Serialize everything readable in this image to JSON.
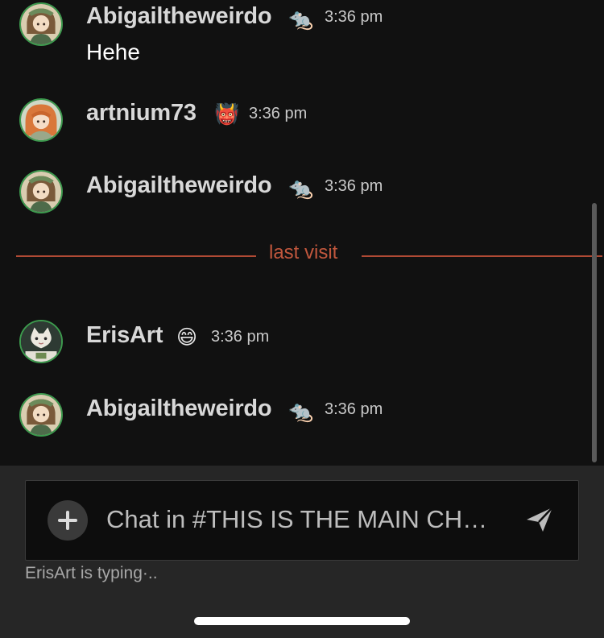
{
  "messages": [
    {
      "username": "Abigailtheweirdo",
      "badge": "🐀",
      "time": "3:36 pm",
      "text": "Hehe",
      "avatar": "anime-girl-avatar"
    },
    {
      "username": "artnium73",
      "badge": "👹",
      "time": "3:36 pm",
      "text": "",
      "avatar": "orange-hair-avatar"
    },
    {
      "username": "Abigailtheweirdo",
      "badge": "🐀",
      "time": "3:36 pm",
      "text": "",
      "avatar": "anime-girl-avatar"
    },
    {
      "username": "ErisArt",
      "badge": "😄",
      "time": "3:36 pm",
      "text": "",
      "avatar": "cat-avatar"
    },
    {
      "username": "Abigailtheweirdo",
      "badge": "🐀",
      "time": "3:36 pm",
      "text": "",
      "avatar": "anime-girl-avatar"
    }
  ],
  "divider": {
    "label": "last visit",
    "color": "#c1573d"
  },
  "composer": {
    "placeholder": "Chat in #THIS IS THE MAIN CH…",
    "plus_icon": "plus-icon",
    "send_icon": "send-icon"
  },
  "typing_indicator": "ErisArt is typing·..",
  "colors": {
    "background": "#111111",
    "avatar_ring": "#3d9a4e",
    "composer_bg": "#262626"
  }
}
